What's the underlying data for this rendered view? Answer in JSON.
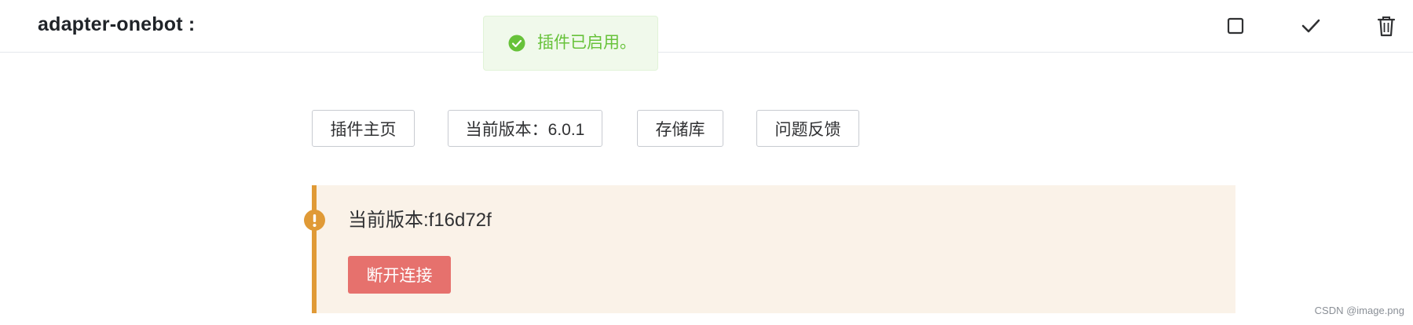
{
  "header": {
    "title": "adapter-onebot :",
    "actions": [
      {
        "icon": "square-icon"
      },
      {
        "icon": "check-icon"
      },
      {
        "icon": "trash-icon"
      }
    ]
  },
  "toast": {
    "icon": "success-check-circle-icon",
    "message": "插件已启用。",
    "color": "#67c23a"
  },
  "links": [
    {
      "label": "插件主页"
    },
    {
      "label": "当前版本：6.0.1"
    },
    {
      "label": "存储库"
    },
    {
      "label": "问题反馈"
    }
  ],
  "alert": {
    "icon": "warning-exclamation-icon",
    "text": "当前版本:f16d72f",
    "button_label": "断开连接",
    "accent_color": "#e09a36",
    "button_color": "#e6716d"
  },
  "watermark": "CSDN @image.png"
}
